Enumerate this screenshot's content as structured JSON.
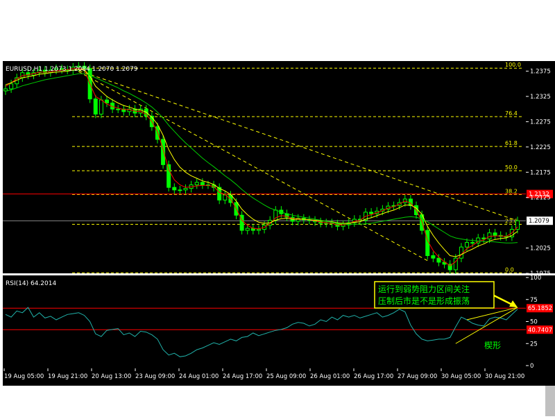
{
  "symbol_header": "EURUSD,H1  1.2073 1.2084 1.2070 1.2079",
  "rsi_header": "RSI(14)  64.2014",
  "colors": {
    "background": "#000000",
    "grid": "#006400",
    "candle": "#00ff00",
    "ma_fast": "#ffff00",
    "ma_slow": "#00cc00",
    "ma_short": "#ff0000",
    "fib_line": "#ffff00",
    "resistance": "#ff0000",
    "rsi_line": "#20b2aa",
    "annotation_text": "#00ff00",
    "callout_border": "#ffff00"
  },
  "annotation": {
    "callout_line1": "运行到弱势阻力区间关注",
    "callout_line2": "压制后市是不是形成振荡",
    "wedge_label": "楔形"
  },
  "chart_data": [
    {
      "type": "candlestick",
      "title": "EURUSD,H1",
      "ohlc_last": {
        "open": 1.2073,
        "high": 1.2084,
        "low": 1.207,
        "close": 1.2079
      },
      "current_price_label": "1.2079",
      "ylim": [
        1.1975,
        1.2395
      ],
      "y_ticks": [
        "1.2375",
        "1.2325",
        "1.2275",
        "1.2225",
        "1.2175",
        "1.2125",
        "1.2025",
        "1.1975"
      ],
      "x_ticks": [
        "19 Aug 05:00",
        "19 Aug 21:00",
        "20 Aug 13:00",
        "23 Aug 09:00",
        "24 Aug 01:00",
        "24 Aug 17:00",
        "25 Aug 09:00",
        "26 Aug 01:00",
        "26 Aug 17:00",
        "27 Aug 09:00",
        "30 Aug 05:00",
        "30 Aug 21:00"
      ],
      "fibonacci": {
        "levels": [
          {
            "label": "100.0",
            "price": 1.2381
          },
          {
            "label": "76.4",
            "price": 1.2285
          },
          {
            "label": "61.8",
            "price": 1.2226
          },
          {
            "label": "50.0",
            "price": 1.2178
          },
          {
            "label": "38.2",
            "price": 1.2131
          },
          {
            "label": "23.6",
            "price": 1.2072
          },
          {
            "label": "0.0",
            "price": 1.1976
          }
        ]
      },
      "resistance_line": {
        "label": "1.2132",
        "price": 1.2132
      },
      "series": [
        {
          "name": "close",
          "values": [
            1.234,
            1.235,
            1.2362,
            1.2372,
            1.2367,
            1.2372,
            1.2377,
            1.2372,
            1.2377,
            1.238,
            1.2378,
            1.2377,
            1.2383,
            1.2385,
            1.238,
            1.232,
            1.229,
            1.2318,
            1.2312,
            1.23,
            1.23,
            1.2295,
            1.23,
            1.2292,
            1.23,
            1.2286,
            1.2265,
            1.224,
            1.219,
            1.2145,
            1.214,
            1.214,
            1.2143,
            1.215,
            1.2155,
            1.215,
            1.215,
            1.2145,
            1.212,
            1.213,
            1.2115,
            1.209,
            1.206,
            1.2064,
            1.206,
            1.2062,
            1.207,
            1.208,
            1.21,
            1.2093,
            1.2086,
            1.2078,
            1.2084,
            1.2081,
            1.208,
            1.2077,
            1.2074,
            1.2075,
            1.2073,
            1.2068,
            1.2071,
            1.2075,
            1.2082,
            1.208,
            1.2096,
            1.2093,
            1.2098,
            1.2102,
            1.2108,
            1.2109,
            1.2115,
            1.2122,
            1.2109,
            1.2091,
            1.206,
            1.201,
            1.2005,
            1.1997,
            1.1993,
            1.1982,
            1.2005,
            1.2027,
            1.2036,
            1.2035,
            1.2045,
            1.2043,
            1.2055,
            1.205,
            1.2048,
            1.2047,
            1.2062,
            1.2079
          ]
        },
        {
          "name": "ma_short",
          "values": [
            1.2345,
            1.2352,
            1.236,
            1.2366,
            1.2368,
            1.237,
            1.2373,
            1.2373,
            1.2374,
            1.2376,
            1.2377,
            1.2378,
            1.238,
            1.2381,
            1.2378,
            1.235,
            1.2325,
            1.2318,
            1.231,
            1.2305,
            1.2302,
            1.2299,
            1.2299,
            1.2296,
            1.2295,
            1.229,
            1.2275,
            1.2255,
            1.222,
            1.218,
            1.216,
            1.215,
            1.2145,
            1.2146,
            1.2148,
            1.2149,
            1.2149,
            1.2147,
            1.2135,
            1.2131,
            1.2122,
            1.2103,
            1.208,
            1.207,
            1.2064,
            1.2063,
            1.2066,
            1.2073,
            1.2085,
            1.2089,
            1.2088,
            1.2083,
            1.2083,
            1.2082,
            1.2081,
            1.2079,
            1.2076,
            1.2075,
            1.2074,
            1.2071,
            1.2071,
            1.2073,
            1.2078,
            1.208,
            1.2088,
            1.2091,
            1.2095,
            1.2099,
            1.2104,
            1.2107,
            1.2112,
            1.2118,
            1.2114,
            1.21,
            1.2078,
            1.204,
            1.202,
            1.2007,
            1.1998,
            1.199,
            1.1998,
            1.2012,
            1.2024,
            1.203,
            1.2038,
            1.2041,
            1.2048,
            1.2049,
            1.2049,
            1.2048,
            1.2055,
            1.2067
          ]
        },
        {
          "name": "ma_fast",
          "values": [
            1.2348,
            1.2352,
            1.2357,
            1.2362,
            1.2364,
            1.2366,
            1.2369,
            1.237,
            1.2372,
            1.2373,
            1.2374,
            1.2375,
            1.2377,
            1.2378,
            1.2378,
            1.2365,
            1.2345,
            1.2335,
            1.2325,
            1.2318,
            1.2312,
            1.2307,
            1.2304,
            1.23,
            1.2298,
            1.2294,
            1.2284,
            1.227,
            1.2248,
            1.222,
            1.22,
            1.2185,
            1.2175,
            1.2168,
            1.2163,
            1.2158,
            1.2155,
            1.2151,
            1.2143,
            1.2138,
            1.2131,
            1.2118,
            1.2102,
            1.2091,
            1.2082,
            1.2076,
            1.2074,
            1.2075,
            1.208,
            1.2083,
            1.2084,
            1.2082,
            1.2082,
            1.2082,
            1.2081,
            1.208,
            1.2079,
            1.2078,
            1.2077,
            1.2075,
            1.2074,
            1.2074,
            1.2076,
            1.2077,
            1.2082,
            1.2085,
            1.2089,
            1.2093,
            1.2097,
            1.21,
            1.2105,
            1.211,
            1.211,
            1.2104,
            1.2092,
            1.2068,
            1.205,
            1.2035,
            1.2022,
            1.201,
            1.2008,
            1.2012,
            1.2018,
            1.2023,
            1.2029,
            1.2033,
            1.2039,
            1.2042,
            1.2044,
            1.2045,
            1.205,
            1.2058
          ]
        },
        {
          "name": "ma_slow",
          "values": [
            1.2335,
            1.2338,
            1.2342,
            1.2346,
            1.2349,
            1.2352,
            1.2355,
            1.2358,
            1.236,
            1.2362,
            1.2364,
            1.2366,
            1.2368,
            1.237,
            1.237,
            1.2367,
            1.2362,
            1.2357,
            1.2352,
            1.2347,
            1.2342,
            1.2336,
            1.2331,
            1.2325,
            1.2319,
            1.2312,
            1.2304,
            1.2294,
            1.2282,
            1.2268,
            1.2256,
            1.2244,
            1.2233,
            1.2223,
            1.2213,
            1.2203,
            1.2194,
            1.2186,
            1.2177,
            1.2168,
            1.216,
            1.2151,
            1.2141,
            1.2132,
            1.2124,
            1.2117,
            1.211,
            1.2104,
            1.21,
            1.2096,
            1.2093,
            1.209,
            1.2088,
            1.2086,
            1.2084,
            1.2082,
            1.208,
            1.2078,
            1.2076,
            1.2074,
            1.2073,
            1.2072,
            1.2072,
            1.2072,
            1.2073,
            1.2074,
            1.2076,
            1.2078,
            1.208,
            1.2082,
            1.2084,
            1.2086,
            1.2087,
            1.2086,
            1.2083,
            1.2077,
            1.207,
            1.2063,
            1.2056,
            1.2049,
            1.2045,
            1.2043,
            1.2041,
            1.204,
            1.2039,
            1.2038,
            1.2038,
            1.2037,
            1.2036,
            1.2035,
            1.2035,
            1.2036
          ]
        }
      ],
      "trendlines": [
        {
          "from": {
            "bar": 12,
            "price": 1.238
          },
          "to": {
            "bar": 75,
            "price": 1.2
          }
        },
        {
          "from": {
            "bar": 12,
            "price": 1.238
          },
          "to": {
            "bar": 91,
            "price": 1.2079
          }
        }
      ]
    },
    {
      "type": "line",
      "title": "RSI(14)",
      "ylim": [
        0,
        100
      ],
      "y_ticks": [
        "100",
        "75",
        "50",
        "25",
        "0"
      ],
      "levels": [
        {
          "label": "65.1852",
          "value": 65.1852
        },
        {
          "label": "40.7407",
          "value": 40.7407
        }
      ],
      "series": [
        {
          "name": "RSI(14)",
          "values": [
            58,
            55,
            62,
            60,
            66,
            55,
            60,
            54,
            56,
            52,
            55,
            58,
            59,
            60,
            57,
            50,
            36,
            33,
            40,
            41,
            42,
            35,
            37,
            33,
            39,
            38,
            35,
            30,
            18,
            12,
            14,
            10,
            11,
            14,
            18,
            20,
            23,
            26,
            24,
            27,
            30,
            28,
            32,
            33,
            37,
            34,
            36,
            38,
            40,
            41,
            43,
            47,
            49,
            48,
            45,
            47,
            52,
            50,
            55,
            52,
            57,
            55,
            57,
            54,
            56,
            58,
            60,
            55,
            57,
            60,
            64,
            61,
            46,
            36,
            30,
            28,
            29,
            30,
            30,
            32,
            44,
            55,
            52,
            48,
            46,
            45,
            53,
            55,
            54,
            52,
            58,
            64
          ]
        }
      ],
      "wedge_lines": [
        {
          "from": {
            "bar": 82,
            "value": 52
          },
          "to": {
            "bar": 91,
            "value": 66
          }
        },
        {
          "from": {
            "bar": 80,
            "value": 25
          },
          "to": {
            "bar": 91,
            "value": 66
          }
        }
      ]
    }
  ]
}
